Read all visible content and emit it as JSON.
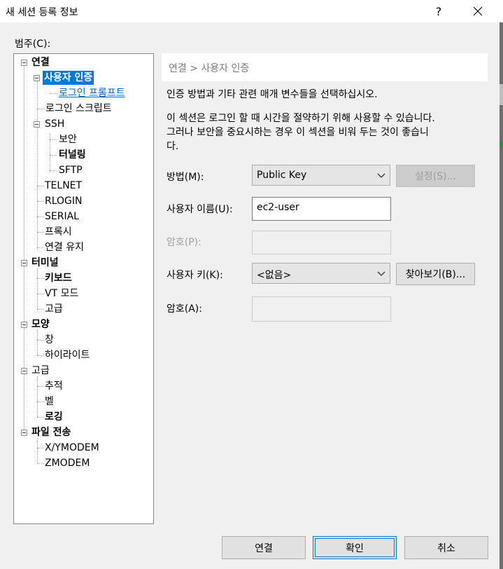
{
  "window": {
    "title": "새 세션 등록 정보",
    "help_label": "?",
    "close_label": "✕"
  },
  "category_label": "범주(C):",
  "tree": {
    "connection": "연결",
    "user_auth": "사용자 인증",
    "login_prompt": "로그인 프롬프트",
    "login_script": "로그인 스크립트",
    "ssh": "SSH",
    "security": "보안",
    "tunneling": "터널링",
    "sftp": "SFTP",
    "telnet": "TELNET",
    "rlogin": "RLOGIN",
    "serial": "SERIAL",
    "proxy": "프록시",
    "keep_alive": "연결 유지",
    "terminal": "터미널",
    "keyboard": "키보드",
    "vt_mode": "VT 모드",
    "term_advanced": "고급",
    "appearance": "모양",
    "window": "창",
    "highlight": "하이라이트",
    "advanced": "고급",
    "trace": "추적",
    "bell": "벨",
    "logging": "로깅",
    "file_transfer": "파일 전송",
    "xymodem": "X/YMODEM",
    "zmodem": "ZMODEM"
  },
  "breadcrumb": "연결 > 사용자 인증",
  "description": {
    "line1": "인증 방법과 기타 관련 매개 변수들을 선택하십시오.",
    "line2a": "이 섹션은 로그인 할 때 시간을 절약하기 위해 사용할 수 있습니다.",
    "line2b": "그러나 보안을 중요시하는 경우 이 섹션을 비워 두는 것이 좋습니",
    "line2c": "다."
  },
  "form": {
    "method_label": "방법(M):",
    "method_value": "Public Key",
    "settings_button": "설정(S)...",
    "username_label": "사용자 이름(U):",
    "username_value": "ec2-user",
    "password_label": "암호(P):",
    "userkey_label": "사용자 키(K):",
    "userkey_value": "<없음>",
    "browse_button": "찾아보기(B)...",
    "passphrase_label": "암호(A):"
  },
  "buttons": {
    "connect": "연결",
    "ok": "확인",
    "cancel": "취소"
  },
  "icons": {
    "chevron": "chevron-down-icon",
    "expander": "tree-collapse-icon"
  }
}
